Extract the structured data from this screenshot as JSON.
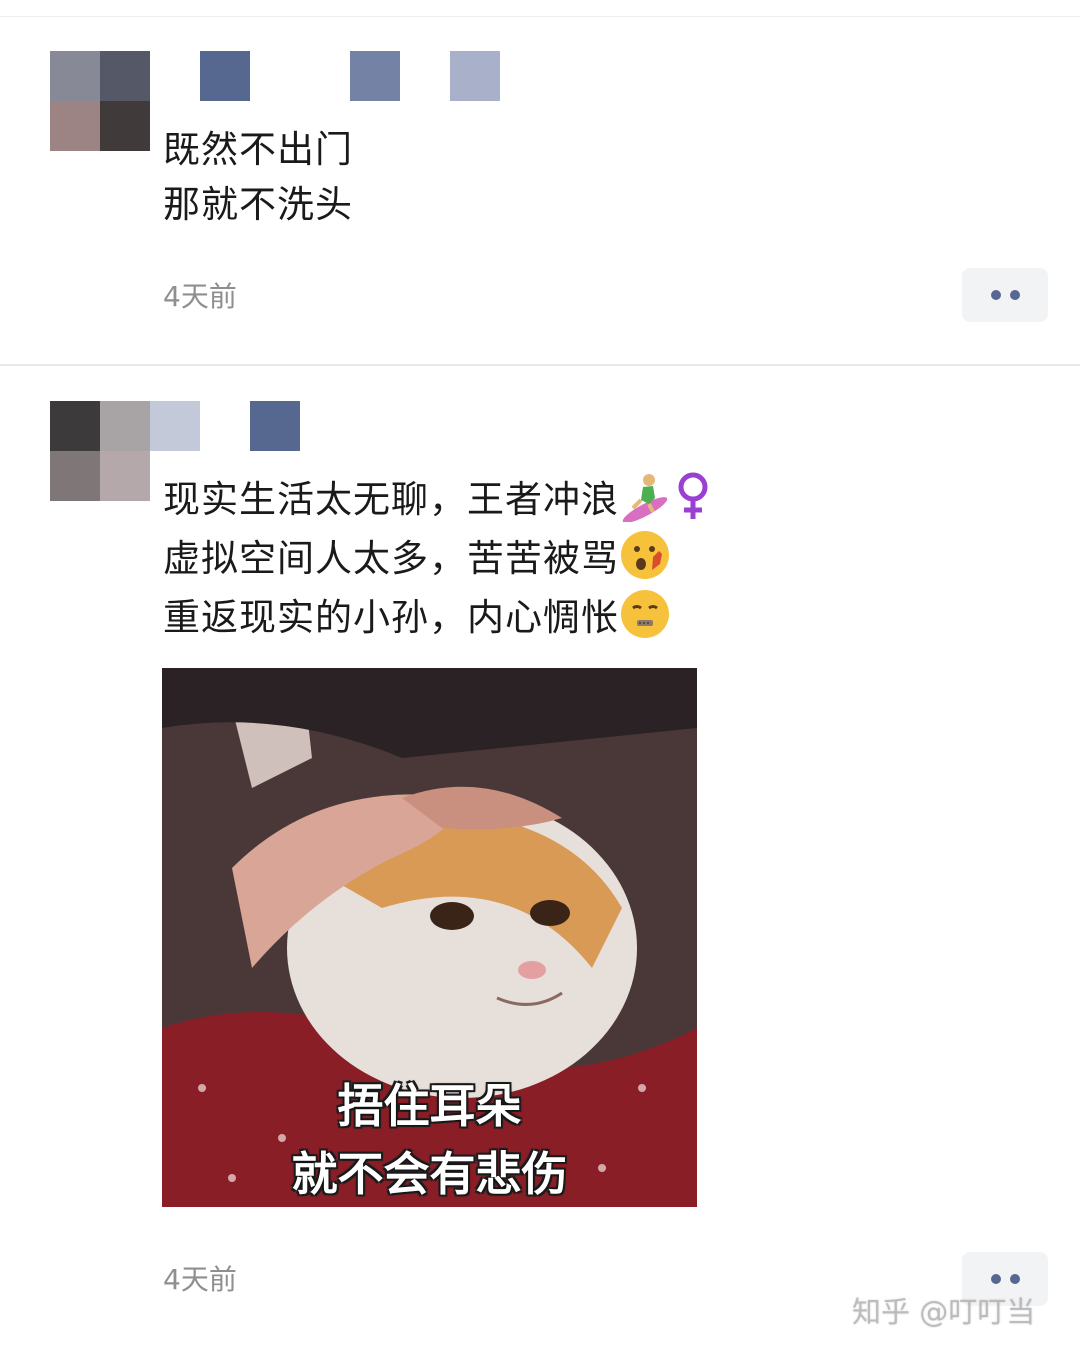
{
  "posts": [
    {
      "content_lines": [
        "既然不出门",
        "那就不洗头"
      ],
      "time": "4天前"
    },
    {
      "content_lines": [
        {
          "text": "现实生活太无聊，王者冲浪",
          "emoji": [
            "woman-surfing-icon",
            "female-sign-icon"
          ]
        },
        {
          "text": "虚拟空间人太多，苦苦被骂",
          "emoji": [
            "hushed-face-hand-icon"
          ]
        },
        {
          "text": "重返现实的小孙，内心惆怅",
          "emoji": [
            "zipper-mouth-face-icon"
          ]
        }
      ],
      "image": {
        "caption_line1": "捂住耳朵",
        "caption_line2": "就不会有悲伤"
      },
      "time": "4天前"
    }
  ],
  "watermark": "知乎 @叮叮当",
  "colors": {
    "more_dot": "#56688f",
    "more_bg": "#f2f3f5",
    "time": "#8f8f8f"
  }
}
